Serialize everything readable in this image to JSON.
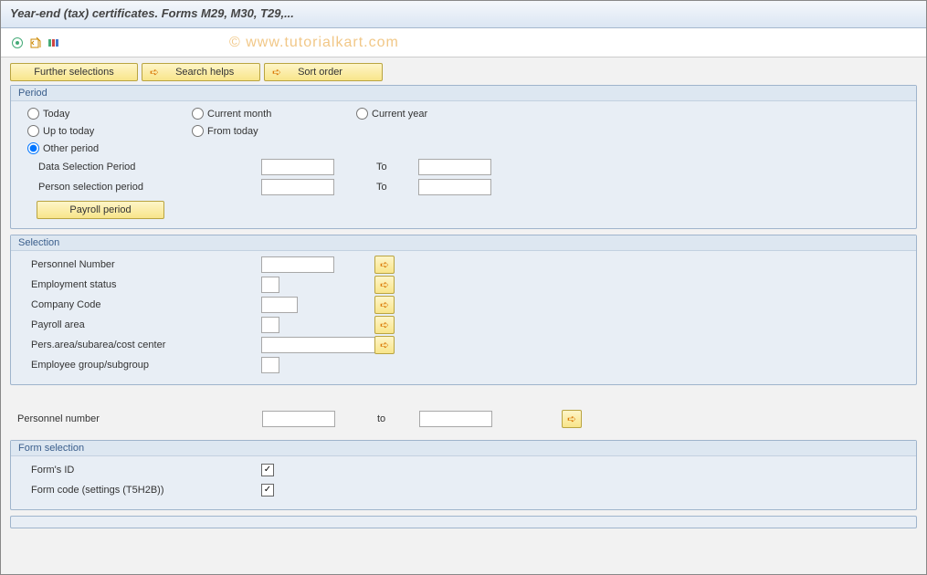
{
  "title": "Year-end (tax) certificates. Forms M29, M30, T29,...",
  "watermark": "© www.tutorialkart.com",
  "buttons": {
    "further_selections": "Further selections",
    "search_helps": "Search helps",
    "sort_order": "Sort order",
    "payroll_period": "Payroll period"
  },
  "period": {
    "header": "Period",
    "today": "Today",
    "current_month": "Current month",
    "current_year": "Current year",
    "up_to_today": "Up to today",
    "from_today": "From today",
    "other_period": "Other period",
    "data_selection_period": "Data Selection Period",
    "person_selection_period": "Person selection period",
    "to": "To"
  },
  "selection": {
    "header": "Selection",
    "personnel_number": "Personnel Number",
    "employment_status": "Employment status",
    "company_code": "Company Code",
    "payroll_area": "Payroll area",
    "pers_area": "Pers.area/subarea/cost center",
    "employee_group": "Employee group/subgroup"
  },
  "range": {
    "personnel_number": "Personnel number",
    "to": "to"
  },
  "form_selection": {
    "header": "Form selection",
    "forms_id": "Form's ID",
    "form_code": "Form code (settings (T5H2B))"
  }
}
